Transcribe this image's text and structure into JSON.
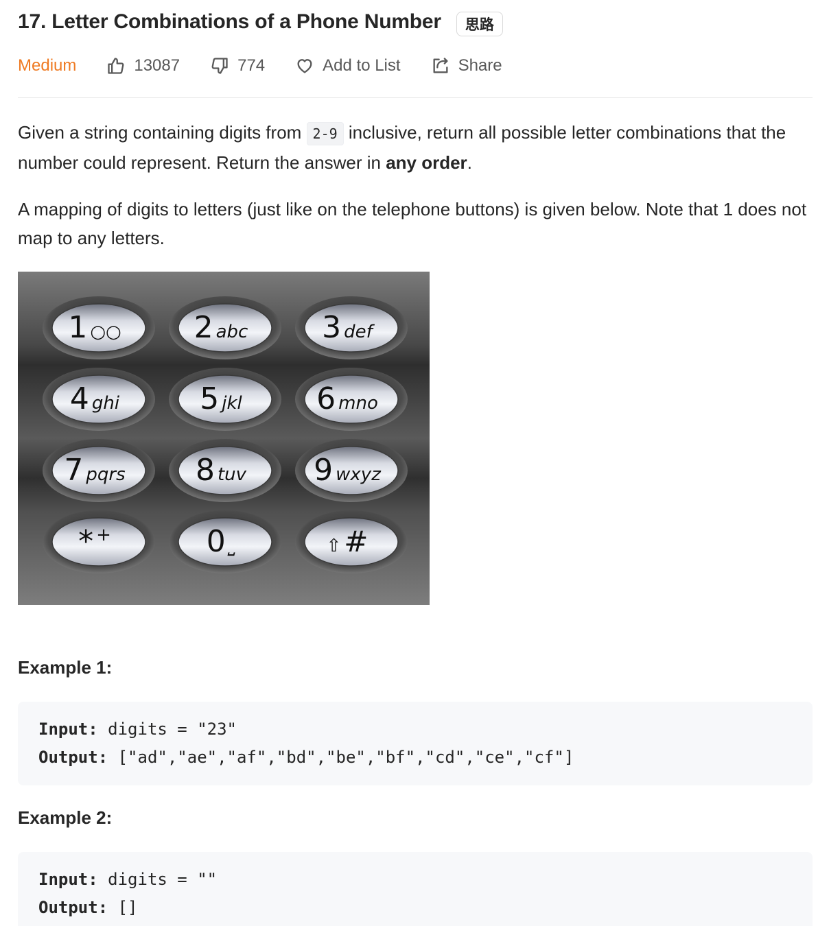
{
  "problem": {
    "title": "17. Letter Combinations of a Phone Number",
    "hint_tag": "思路",
    "difficulty": "Medium",
    "likes": "13087",
    "dislikes": "774",
    "add_to_list_label": "Add to List",
    "share_label": "Share"
  },
  "description": {
    "p1_before": "Given a string containing digits from ",
    "p1_code": "2-9",
    "p1_after": " inclusive, return all possible letter combinations that the number could represent. Return the answer in ",
    "p1_bold": "any order",
    "p1_end": ".",
    "p2": "A mapping of digits to letters (just like on the telephone buttons) is given below. Note that 1 does not map to any letters."
  },
  "keypad": {
    "keys": [
      {
        "digit": "1",
        "letters": "○○"
      },
      {
        "digit": "2",
        "letters": "abc"
      },
      {
        "digit": "3",
        "letters": "def"
      },
      {
        "digit": "4",
        "letters": "ghi"
      },
      {
        "digit": "5",
        "letters": "jkl"
      },
      {
        "digit": "6",
        "letters": "mno"
      },
      {
        "digit": "7",
        "letters": "pqrs"
      },
      {
        "digit": "8",
        "letters": "tuv"
      },
      {
        "digit": "9",
        "letters": "wxyz"
      },
      {
        "digit": "*",
        "letters": "+"
      },
      {
        "digit": "0",
        "letters": "⎵"
      },
      {
        "digit": "#",
        "letters": "⇧"
      }
    ]
  },
  "examples": [
    {
      "heading": "Example 1:",
      "input_label": "Input:",
      "input_value": " digits = \"23\"",
      "output_label": "Output:",
      "output_value": " [\"ad\",\"ae\",\"af\",\"bd\",\"be\",\"bf\",\"cd\",\"ce\",\"cf\"]"
    },
    {
      "heading": "Example 2:",
      "input_label": "Input:",
      "input_value": " digits = \"\"",
      "output_label": "Output:",
      "output_value": " []"
    }
  ],
  "colors": {
    "difficulty_medium": "#ef7a22",
    "text": "#262626",
    "meta_text": "#595959",
    "code_bg": "#f7f8fa"
  }
}
